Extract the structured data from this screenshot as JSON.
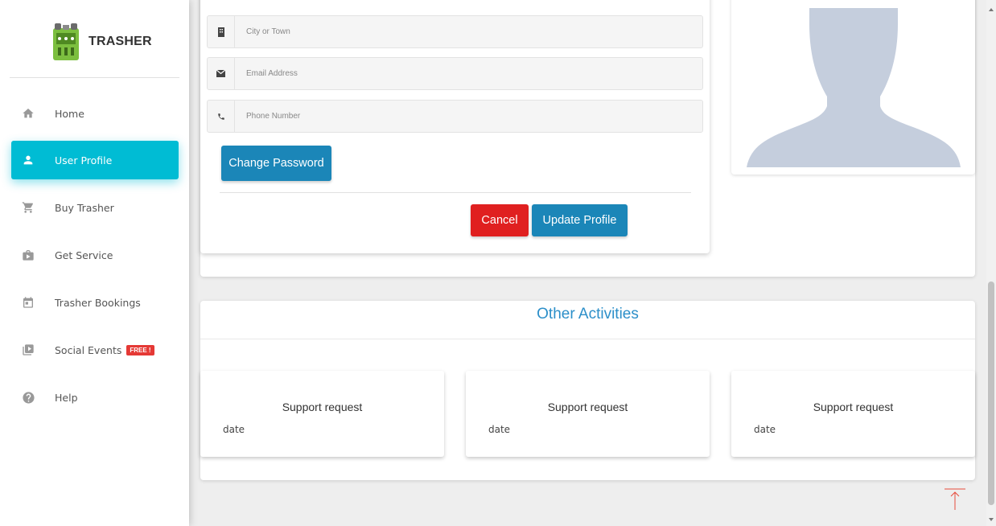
{
  "app": {
    "name": "TRASHER"
  },
  "sidebar": {
    "items": [
      {
        "label": "Home",
        "icon": "home-icon"
      },
      {
        "label": "User Profile",
        "icon": "person-icon",
        "active": true
      },
      {
        "label": "Buy Trasher",
        "icon": "cart-icon"
      },
      {
        "label": "Get Service",
        "icon": "briefcase-play-icon"
      },
      {
        "label": "Trasher Bookings",
        "icon": "calendar-icon"
      },
      {
        "label": "Social Events",
        "icon": "slideshow-icon",
        "badge": "FREE !"
      },
      {
        "label": "Help",
        "icon": "help-icon"
      }
    ]
  },
  "form": {
    "city_placeholder": "City or Town",
    "email_placeholder": "Email Address",
    "phone_placeholder": "Phone Number",
    "change_password_label": "Change Password",
    "cancel_label": "Cancel",
    "update_label": "Update Profile"
  },
  "activities": {
    "title": "Other Activities",
    "cards": [
      {
        "title": "Support request",
        "date": "date"
      },
      {
        "title": "Support request",
        "date": "date"
      },
      {
        "title": "Support request",
        "date": "date"
      }
    ]
  },
  "colors": {
    "accent": "#00bcd4",
    "primary_button": "#1b86b8",
    "cancel_button": "#e02020",
    "heading": "#2c8fc9",
    "badge": "#e53935"
  }
}
